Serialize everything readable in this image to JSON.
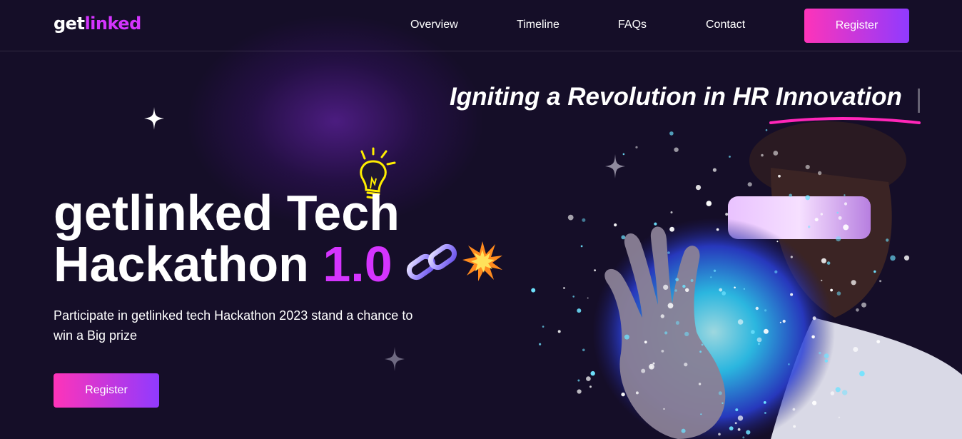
{
  "logo": {
    "prefix": "get",
    "accent": "linked"
  },
  "nav": {
    "links": [
      {
        "label": "Overview"
      },
      {
        "label": "Timeline"
      },
      {
        "label": "FAQs"
      },
      {
        "label": "Contact"
      }
    ],
    "register_label": "Register"
  },
  "hero": {
    "tagline_main": "Igniting a Revolution in ",
    "tagline_highlight": "HR Innovation",
    "title_line1": "getlinked Tech",
    "title_line2_prefix": "Hackathon ",
    "title_version": "1.0",
    "subtext": "Participate in getlinked tech Hackathon 2023 stand a chance to win a Big prize",
    "register_label": "Register"
  },
  "colors": {
    "background": "#150e28",
    "accent": "#d434fe",
    "button_gradient_start": "#fe34b9",
    "button_gradient_end": "#903aff",
    "text": "#ffffff"
  },
  "icons": [
    "sparkle-star-icon",
    "lightbulb-icon",
    "chain-link-icon",
    "collision-burst-icon"
  ]
}
